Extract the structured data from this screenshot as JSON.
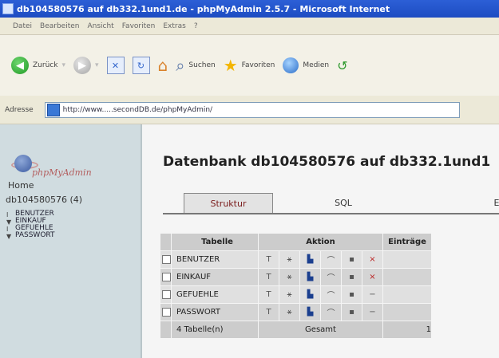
{
  "window": {
    "title": "db104580576 auf db332.1und1.de - phpMyAdmin 2.5.7 - Microsoft Internet"
  },
  "menubar": {
    "items": [
      "Datei",
      "Bearbeiten",
      "Ansicht",
      "Favoriten",
      "Extras",
      "?"
    ]
  },
  "toolbar": {
    "back_label": "Zurück",
    "search_label": "Suchen",
    "favorites_label": "Favoriten",
    "media_label": "Medien"
  },
  "address": {
    "label": "Adresse",
    "url": "http://www.....secondDB.de/phpMyAdmin/"
  },
  "sidebar": {
    "logo_text": "phpMyAdmin",
    "home_label": "Home",
    "db_name": "db104580576 (4)",
    "tables": [
      "BENUTZER",
      "EINKAUF",
      "GEFUEHLE",
      "PASSWORT"
    ]
  },
  "main": {
    "heading": "Datenbank db104580576 auf db332.1und1",
    "tabs": {
      "structure": "Struktur",
      "sql": "SQL",
      "export": "E"
    },
    "table": {
      "headers": {
        "name": "Tabelle",
        "action": "Aktion",
        "rows": "Einträge"
      },
      "rows": [
        "BENUTZER",
        "EINKAUF",
        "GEFUEHLE",
        "PASSWORT"
      ],
      "footer": {
        "count": "4 Tabelle(n)",
        "sum": "Gesamt",
        "rows": "1"
      }
    }
  }
}
